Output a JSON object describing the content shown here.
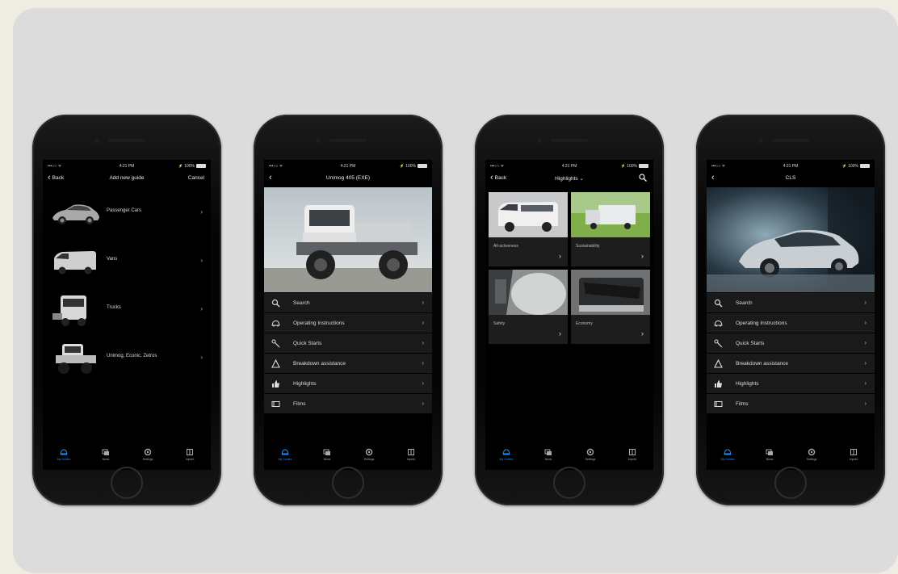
{
  "status": {
    "signal": "•••○○ ᯤ",
    "time": "4:21 PM",
    "battery": "⚡ 100%"
  },
  "phone1": {
    "nav": {
      "back": "Back",
      "title": "Add new guide",
      "right": "Cancel"
    },
    "items": [
      {
        "label": "Passenger Cars"
      },
      {
        "label": "Vans"
      },
      {
        "label": "Trucks"
      },
      {
        "label": "Unimog, Econic, Zetros"
      }
    ]
  },
  "phone2": {
    "nav": {
      "title": "Unimog 405 (EXE)"
    },
    "menu": [
      {
        "label": "Search"
      },
      {
        "label": "Operating Instructions"
      },
      {
        "label": "Quick Starts"
      },
      {
        "label": "Breakdown assistance"
      },
      {
        "label": "Highlights"
      },
      {
        "label": "Films"
      }
    ]
  },
  "phone3": {
    "nav": {
      "back": "Back",
      "title": "Highlights ⌄"
    },
    "tiles": [
      {
        "label": "All-activeness"
      },
      {
        "label": "Sustainability"
      },
      {
        "label": "Safety"
      },
      {
        "label": "Economy"
      }
    ]
  },
  "phone4": {
    "nav": {
      "title": "CLS"
    },
    "menu": [
      {
        "label": "Search"
      },
      {
        "label": "Operating Instructions"
      },
      {
        "label": "Quick Starts"
      },
      {
        "label": "Breakdown assistance"
      },
      {
        "label": "Highlights"
      },
      {
        "label": "Films"
      }
    ]
  },
  "tabbar": [
    {
      "label": "My Guides",
      "icon": "car-icon",
      "active": true
    },
    {
      "label": "News",
      "icon": "news-icon"
    },
    {
      "label": "Settings",
      "icon": "settings-icon"
    },
    {
      "label": "Imprint",
      "icon": "imprint-icon"
    }
  ],
  "colors": {
    "accent": "#1e90ff",
    "panel": "#dcdcdc",
    "background": "#efece2"
  }
}
